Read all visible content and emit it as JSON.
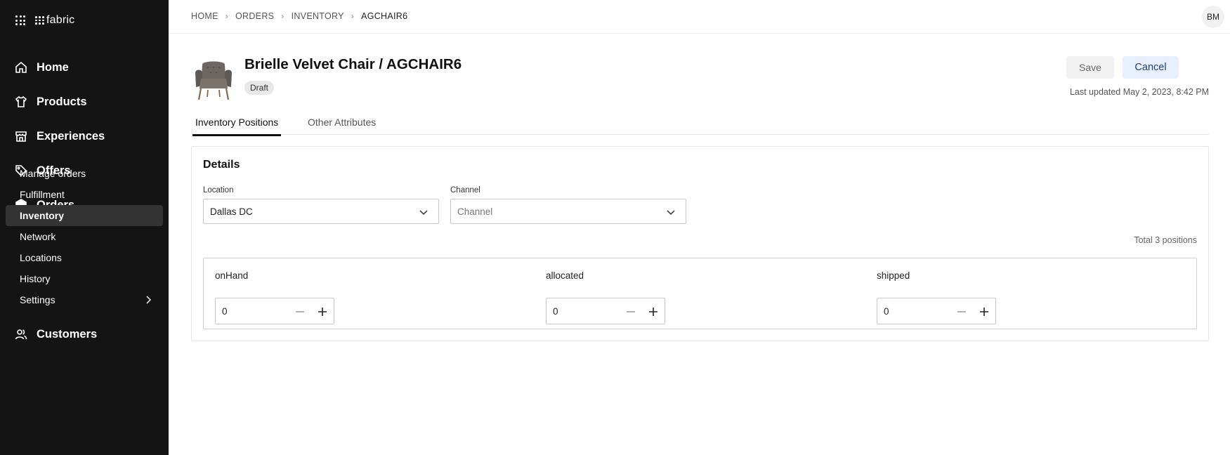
{
  "brand": {
    "logo_text": "fabric"
  },
  "sidebar": {
    "primary": [
      {
        "label": "Home",
        "icon": "home-icon"
      },
      {
        "label": "Products",
        "icon": "shirt-icon"
      },
      {
        "label": "Experiences",
        "icon": "storefront-icon"
      },
      {
        "label": "Offers",
        "icon": "tag-icon"
      },
      {
        "label": "Orders",
        "icon": "box-icon"
      }
    ],
    "orders_items": [
      {
        "label": "Manage orders"
      },
      {
        "label": "Fulfillment"
      },
      {
        "label": "Inventory",
        "active": true
      },
      {
        "label": "Network"
      },
      {
        "label": "Locations"
      },
      {
        "label": "History"
      },
      {
        "label": "Settings"
      }
    ],
    "customers": {
      "label": "Customers",
      "icon": "users-icon"
    }
  },
  "breadcrumb": [
    "HOME",
    "ORDERS",
    "INVENTORY",
    "AGCHAIR6"
  ],
  "user": {
    "initials": "BM"
  },
  "header": {
    "title": "Brielle Velvet Chair / AGCHAIR6",
    "status": "Draft",
    "save_label": "Save",
    "cancel_label": "Cancel",
    "last_updated": "Last updated May 2, 2023, 8:42 PM"
  },
  "tabs": [
    {
      "label": "Inventory Positions",
      "active": true
    },
    {
      "label": "Other Attributes",
      "active": false
    }
  ],
  "details": {
    "title": "Details",
    "location": {
      "label": "Location",
      "value": "Dallas DC"
    },
    "channel": {
      "label": "Channel",
      "placeholder": "Channel"
    },
    "total": "Total 3 positions",
    "positions": [
      {
        "label": "onHand",
        "value": "0"
      },
      {
        "label": "allocated",
        "value": "0"
      },
      {
        "label": "shipped",
        "value": "0"
      }
    ]
  },
  "colors": {
    "sidebar_bg": "#141414",
    "active_item_bg": "#333333",
    "cancel_bg": "#e8f0fe",
    "cancel_text": "#1a3e8c"
  }
}
